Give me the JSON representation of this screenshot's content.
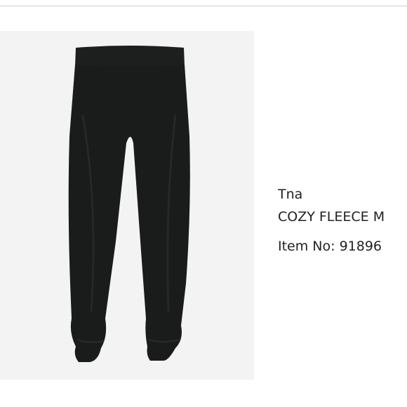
{
  "product": {
    "brand": "Tna",
    "name": "COZY FLEECE M",
    "item_number": "Item No: 91896"
  },
  "image": {
    "subject": "pants-photo",
    "background_color": "#f3f3f3",
    "garment_color": "#1a1c1c"
  },
  "colors": {
    "text": "#222222",
    "divider": "#cfcfcf"
  }
}
